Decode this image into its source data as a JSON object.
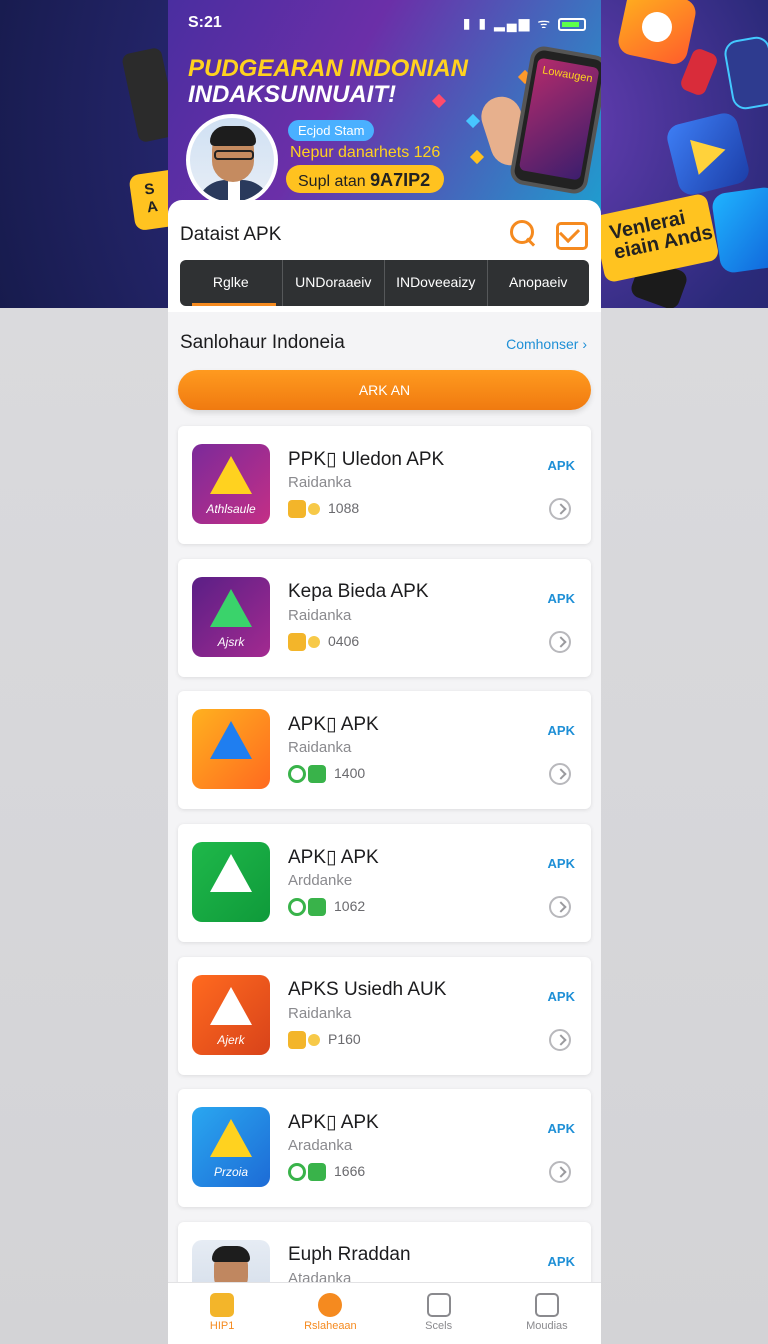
{
  "status_bar": {
    "time": "S:21",
    "icons": "▮ ▮ ▂▄▆ ᯤ"
  },
  "banner": {
    "title_line1": "PUDGEARAN INDONIAN",
    "title_line2": "INDAKSUNNUAIT!",
    "pill": "Ecjod Stam",
    "line1": "Nepur danarhets 126",
    "pill2_prefix": "Supl atan",
    "pill2_code": "9A7IP2",
    "device_text": "Lowaugen",
    "left_badge": "S\nA",
    "right_badge": "Venlerai\neiain Ands"
  },
  "header": {
    "title": "Dataist APK",
    "search_icon": "search-icon",
    "mail_icon": "mail-icon"
  },
  "tabs": [
    {
      "label": "Rglke",
      "active": true
    },
    {
      "label": "UNDoraaeiv",
      "active": false
    },
    {
      "label": "INDoveeaizy",
      "active": false
    },
    {
      "label": "Anopaeiv",
      "active": false
    }
  ],
  "section": {
    "title": "Sanlohaur Indoneia",
    "link": "Comhonser ›",
    "button": "ARK AN"
  },
  "apps": [
    {
      "name": "PPK▯ Uledon APK",
      "sub": "Raidanka",
      "meta": "1088",
      "badge": "APK",
      "icon_caption": "Athlsaule",
      "meta_style": "gold",
      "colors": [
        "#7b2a9a",
        "#c42f86"
      ]
    },
    {
      "name": "Kepa Bieda APK",
      "sub": "Raidanka",
      "meta": "0406",
      "badge": "APK",
      "icon_caption": "Ajsrk",
      "meta_style": "gold",
      "colors": [
        "#5a1f86",
        "#a32a90"
      ]
    },
    {
      "name": "APK▯ APK",
      "sub": "Raidanka",
      "meta": "1400",
      "badge": "APK",
      "icon_caption": "",
      "meta_style": "green",
      "colors": [
        "#ffb11f",
        "#ff6a1f"
      ]
    },
    {
      "name": "APK▯ APK",
      "sub": "Arddanke",
      "meta": "1062",
      "badge": "APK",
      "icon_caption": "",
      "meta_style": "green",
      "colors": [
        "#1fb84a",
        "#0f9a3a"
      ]
    },
    {
      "name": "APKS Usiedh AUK",
      "sub": "Raidanka",
      "meta": "P160",
      "badge": "APK",
      "icon_caption": "Ajerk",
      "meta_style": "gold",
      "colors": [
        "#ff6a1f",
        "#d8431a"
      ]
    },
    {
      "name": "APK▯ APK",
      "sub": "Aradanka",
      "meta": "1666",
      "badge": "APK",
      "icon_caption": "Przoia",
      "meta_style": "green",
      "colors": [
        "#2aa7f0",
        "#1d6bd6"
      ]
    },
    {
      "name": "Euph Rraddan",
      "sub": "Atadanka",
      "meta": "",
      "badge": "APK",
      "icon_caption": "",
      "meta_style": "none",
      "colors": [
        "#e6ecf4",
        "#cfd9e6"
      ]
    }
  ],
  "bottom_nav": [
    {
      "label": "HIP1",
      "icon": "home-icon"
    },
    {
      "label": "Rslaheaan",
      "icon": "compass-icon"
    },
    {
      "label": "Scels",
      "icon": "document-icon"
    },
    {
      "label": "Moudias",
      "icon": "briefcase-icon"
    }
  ]
}
